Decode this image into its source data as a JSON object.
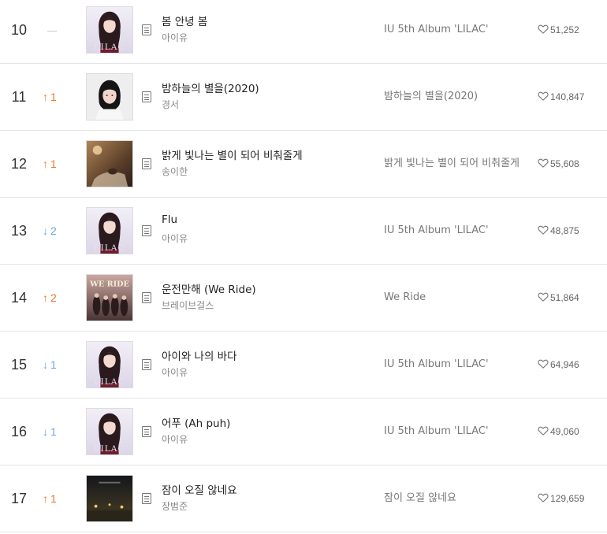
{
  "rows": [
    {
      "rank": "10",
      "change": {
        "dir": "same",
        "value": ""
      },
      "title": "봄 안녕 봄",
      "artist": "아이유",
      "album": "IU 5th Album 'LILAC'",
      "likes": "51,252",
      "cover": "lilac"
    },
    {
      "rank": "11",
      "change": {
        "dir": "up",
        "value": "1"
      },
      "title": "밤하늘의 별을(2020)",
      "artist": "경서",
      "album": "밤하늘의 별을(2020)",
      "likes": "140,847",
      "cover": "portrait"
    },
    {
      "rank": "12",
      "change": {
        "dir": "up",
        "value": "1"
      },
      "title": "밝게 빛나는 별이 되어 비춰줄게",
      "artist": "송이한",
      "album": "밝게 빛나는 별이 되어 비춰줄게",
      "likes": "55,608",
      "cover": "warm"
    },
    {
      "rank": "13",
      "change": {
        "dir": "down",
        "value": "2"
      },
      "title": "Flu",
      "artist": "아이유",
      "album": "IU 5th Album 'LILAC'",
      "likes": "48,875",
      "cover": "lilac"
    },
    {
      "rank": "14",
      "change": {
        "dir": "up",
        "value": "2"
      },
      "title": "운전만해 (We Ride)",
      "artist": "브레이브걸스",
      "album": "We Ride",
      "likes": "51,864",
      "cover": "weride"
    },
    {
      "rank": "15",
      "change": {
        "dir": "down",
        "value": "1"
      },
      "title": "아이와 나의 바다",
      "artist": "아이유",
      "album": "IU 5th Album 'LILAC'",
      "likes": "64,946",
      "cover": "lilac"
    },
    {
      "rank": "16",
      "change": {
        "dir": "down",
        "value": "1"
      },
      "title": "어푸 (Ah puh)",
      "artist": "아이유",
      "album": "IU 5th Album 'LILAC'",
      "likes": "49,060",
      "cover": "lilac"
    },
    {
      "rank": "17",
      "change": {
        "dir": "up",
        "value": "1"
      },
      "title": "잠이 오질 않네요",
      "artist": "장범준",
      "album": "잠이 오질 않네요",
      "likes": "129,659",
      "cover": "night"
    }
  ],
  "cover_text": {
    "lilac": "LILAC",
    "weride": "WE RIDE"
  },
  "colors": {
    "up": "#f0752b",
    "down": "#6aa6e8",
    "same": "#c8c8c8"
  }
}
